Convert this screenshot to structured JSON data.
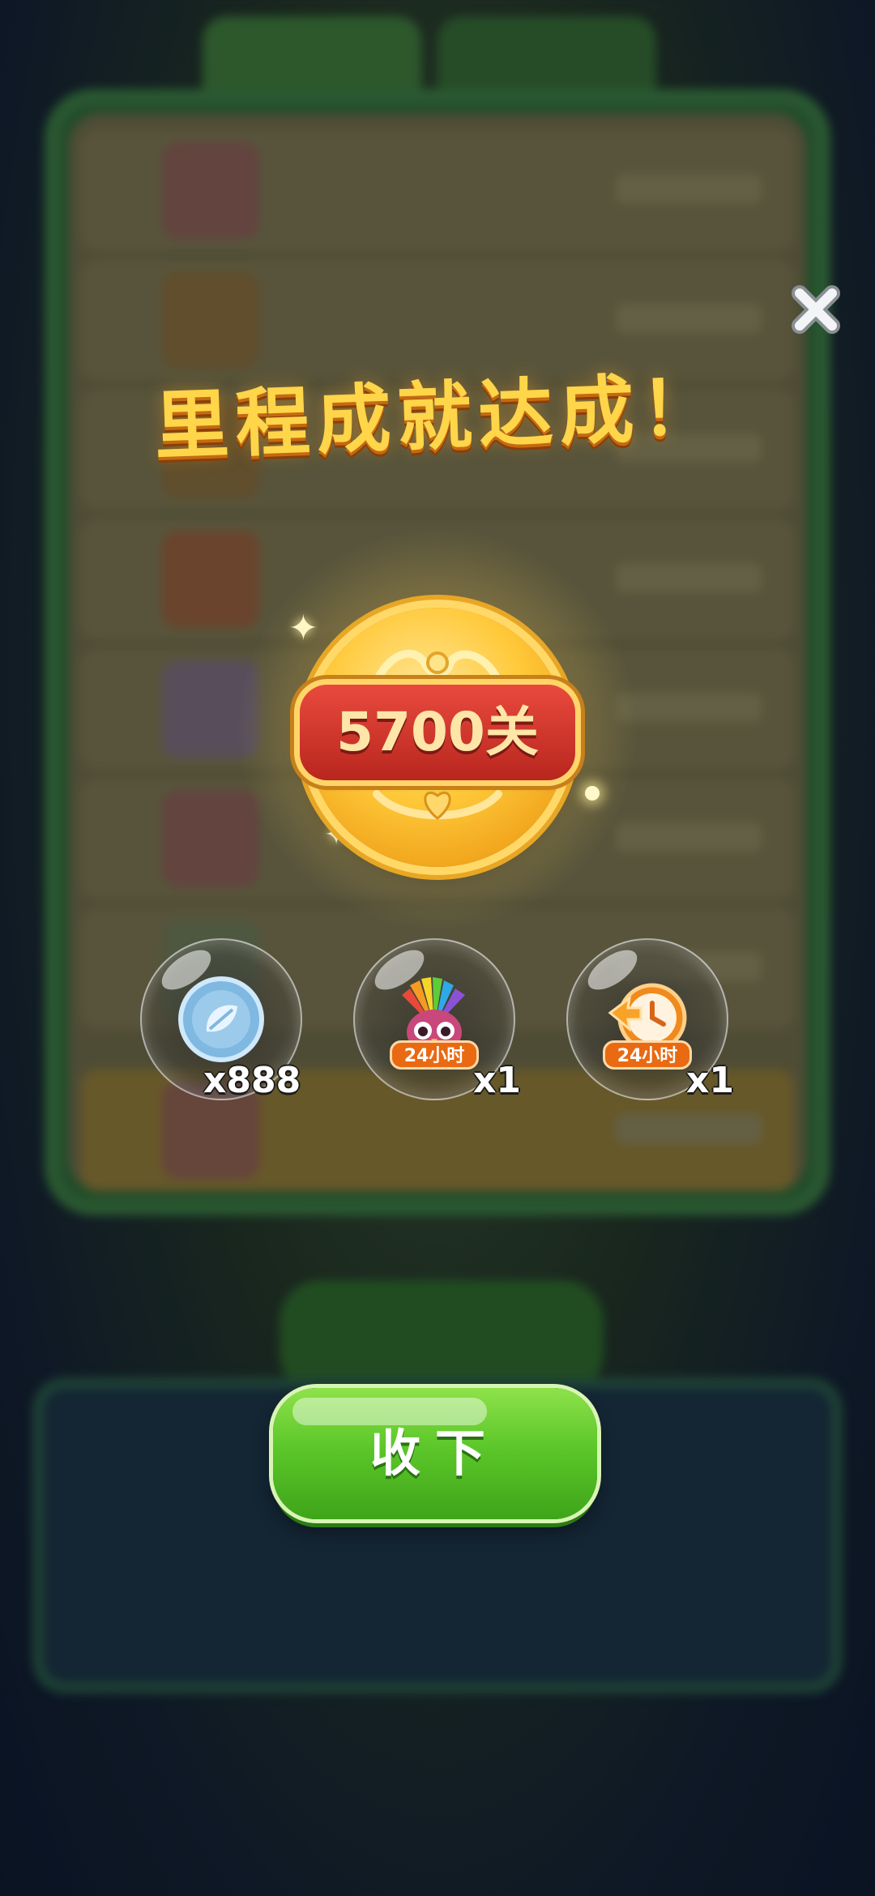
{
  "popup": {
    "title": "里程成就达成！",
    "medal_label": "5700关",
    "close_icon": "close-x-icon",
    "rewards": [
      {
        "name": "coin",
        "icon": "blue-coin-icon",
        "count": "x888",
        "tag": ""
      },
      {
        "name": "feather-owl",
        "icon": "rainbow-owl-icon",
        "count": "x1",
        "tag": "24小时"
      },
      {
        "name": "time-boost",
        "icon": "clock-boost-icon",
        "count": "x1",
        "tag": "24小时"
      }
    ],
    "accept_label": "收下"
  },
  "colors": {
    "title": "#ffd54a",
    "button_green": "#5cc72a",
    "banner_red": "#e94a3d",
    "medal_gold": "#ffc93a"
  }
}
